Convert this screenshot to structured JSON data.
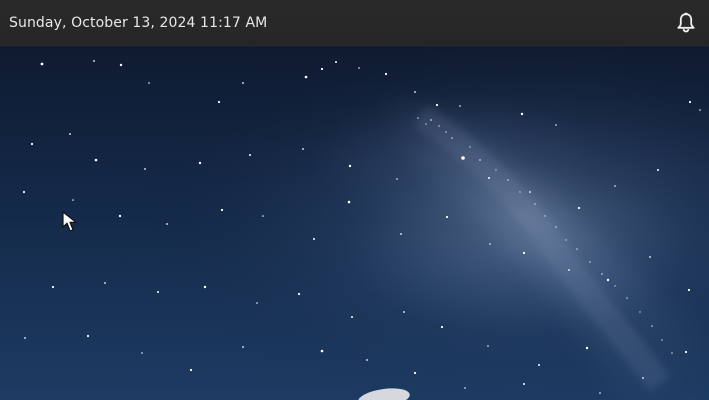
{
  "desktop": {
    "datetime": "Sunday, October 13, 2024 11:17 AM",
    "notification_icon": "bell-icon",
    "wallpaper_icon": "starry-sky-wallpaper",
    "cursor_icon": "mouse-pointer-icon"
  },
  "colors": {
    "topbar": "#262626",
    "clock_text": "#e8e8e8",
    "sky_top": "#0d1628",
    "sky_bottom": "#1d3b63"
  }
}
